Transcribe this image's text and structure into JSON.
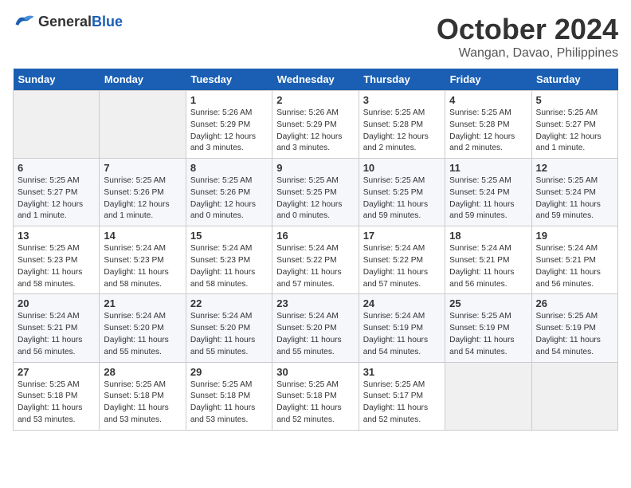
{
  "logo": {
    "general": "General",
    "blue": "Blue"
  },
  "title": "October 2024",
  "location": "Wangan, Davao, Philippines",
  "days_of_week": [
    "Sunday",
    "Monday",
    "Tuesday",
    "Wednesday",
    "Thursday",
    "Friday",
    "Saturday"
  ],
  "weeks": [
    [
      {
        "day": "",
        "sunrise": "",
        "sunset": "",
        "daylight": "",
        "empty": true
      },
      {
        "day": "",
        "sunrise": "",
        "sunset": "",
        "daylight": "",
        "empty": true
      },
      {
        "day": "1",
        "sunrise": "Sunrise: 5:26 AM",
        "sunset": "Sunset: 5:29 PM",
        "daylight": "Daylight: 12 hours and 3 minutes."
      },
      {
        "day": "2",
        "sunrise": "Sunrise: 5:26 AM",
        "sunset": "Sunset: 5:29 PM",
        "daylight": "Daylight: 12 hours and 3 minutes."
      },
      {
        "day": "3",
        "sunrise": "Sunrise: 5:25 AM",
        "sunset": "Sunset: 5:28 PM",
        "daylight": "Daylight: 12 hours and 2 minutes."
      },
      {
        "day": "4",
        "sunrise": "Sunrise: 5:25 AM",
        "sunset": "Sunset: 5:28 PM",
        "daylight": "Daylight: 12 hours and 2 minutes."
      },
      {
        "day": "5",
        "sunrise": "Sunrise: 5:25 AM",
        "sunset": "Sunset: 5:27 PM",
        "daylight": "Daylight: 12 hours and 1 minute."
      }
    ],
    [
      {
        "day": "6",
        "sunrise": "Sunrise: 5:25 AM",
        "sunset": "Sunset: 5:27 PM",
        "daylight": "Daylight: 12 hours and 1 minute."
      },
      {
        "day": "7",
        "sunrise": "Sunrise: 5:25 AM",
        "sunset": "Sunset: 5:26 PM",
        "daylight": "Daylight: 12 hours and 1 minute."
      },
      {
        "day": "8",
        "sunrise": "Sunrise: 5:25 AM",
        "sunset": "Sunset: 5:26 PM",
        "daylight": "Daylight: 12 hours and 0 minutes."
      },
      {
        "day": "9",
        "sunrise": "Sunrise: 5:25 AM",
        "sunset": "Sunset: 5:25 PM",
        "daylight": "Daylight: 12 hours and 0 minutes."
      },
      {
        "day": "10",
        "sunrise": "Sunrise: 5:25 AM",
        "sunset": "Sunset: 5:25 PM",
        "daylight": "Daylight: 11 hours and 59 minutes."
      },
      {
        "day": "11",
        "sunrise": "Sunrise: 5:25 AM",
        "sunset": "Sunset: 5:24 PM",
        "daylight": "Daylight: 11 hours and 59 minutes."
      },
      {
        "day": "12",
        "sunrise": "Sunrise: 5:25 AM",
        "sunset": "Sunset: 5:24 PM",
        "daylight": "Daylight: 11 hours and 59 minutes."
      }
    ],
    [
      {
        "day": "13",
        "sunrise": "Sunrise: 5:25 AM",
        "sunset": "Sunset: 5:23 PM",
        "daylight": "Daylight: 11 hours and 58 minutes."
      },
      {
        "day": "14",
        "sunrise": "Sunrise: 5:24 AM",
        "sunset": "Sunset: 5:23 PM",
        "daylight": "Daylight: 11 hours and 58 minutes."
      },
      {
        "day": "15",
        "sunrise": "Sunrise: 5:24 AM",
        "sunset": "Sunset: 5:23 PM",
        "daylight": "Daylight: 11 hours and 58 minutes."
      },
      {
        "day": "16",
        "sunrise": "Sunrise: 5:24 AM",
        "sunset": "Sunset: 5:22 PM",
        "daylight": "Daylight: 11 hours and 57 minutes."
      },
      {
        "day": "17",
        "sunrise": "Sunrise: 5:24 AM",
        "sunset": "Sunset: 5:22 PM",
        "daylight": "Daylight: 11 hours and 57 minutes."
      },
      {
        "day": "18",
        "sunrise": "Sunrise: 5:24 AM",
        "sunset": "Sunset: 5:21 PM",
        "daylight": "Daylight: 11 hours and 56 minutes."
      },
      {
        "day": "19",
        "sunrise": "Sunrise: 5:24 AM",
        "sunset": "Sunset: 5:21 PM",
        "daylight": "Daylight: 11 hours and 56 minutes."
      }
    ],
    [
      {
        "day": "20",
        "sunrise": "Sunrise: 5:24 AM",
        "sunset": "Sunset: 5:21 PM",
        "daylight": "Daylight: 11 hours and 56 minutes."
      },
      {
        "day": "21",
        "sunrise": "Sunrise: 5:24 AM",
        "sunset": "Sunset: 5:20 PM",
        "daylight": "Daylight: 11 hours and 55 minutes."
      },
      {
        "day": "22",
        "sunrise": "Sunrise: 5:24 AM",
        "sunset": "Sunset: 5:20 PM",
        "daylight": "Daylight: 11 hours and 55 minutes."
      },
      {
        "day": "23",
        "sunrise": "Sunrise: 5:24 AM",
        "sunset": "Sunset: 5:20 PM",
        "daylight": "Daylight: 11 hours and 55 minutes."
      },
      {
        "day": "24",
        "sunrise": "Sunrise: 5:24 AM",
        "sunset": "Sunset: 5:19 PM",
        "daylight": "Daylight: 11 hours and 54 minutes."
      },
      {
        "day": "25",
        "sunrise": "Sunrise: 5:25 AM",
        "sunset": "Sunset: 5:19 PM",
        "daylight": "Daylight: 11 hours and 54 minutes."
      },
      {
        "day": "26",
        "sunrise": "Sunrise: 5:25 AM",
        "sunset": "Sunset: 5:19 PM",
        "daylight": "Daylight: 11 hours and 54 minutes."
      }
    ],
    [
      {
        "day": "27",
        "sunrise": "Sunrise: 5:25 AM",
        "sunset": "Sunset: 5:18 PM",
        "daylight": "Daylight: 11 hours and 53 minutes."
      },
      {
        "day": "28",
        "sunrise": "Sunrise: 5:25 AM",
        "sunset": "Sunset: 5:18 PM",
        "daylight": "Daylight: 11 hours and 53 minutes."
      },
      {
        "day": "29",
        "sunrise": "Sunrise: 5:25 AM",
        "sunset": "Sunset: 5:18 PM",
        "daylight": "Daylight: 11 hours and 53 minutes."
      },
      {
        "day": "30",
        "sunrise": "Sunrise: 5:25 AM",
        "sunset": "Sunset: 5:18 PM",
        "daylight": "Daylight: 11 hours and 52 minutes."
      },
      {
        "day": "31",
        "sunrise": "Sunrise: 5:25 AM",
        "sunset": "Sunset: 5:17 PM",
        "daylight": "Daylight: 11 hours and 52 minutes."
      },
      {
        "day": "",
        "sunrise": "",
        "sunset": "",
        "daylight": "",
        "empty": true
      },
      {
        "day": "",
        "sunrise": "",
        "sunset": "",
        "daylight": "",
        "empty": true
      }
    ]
  ]
}
